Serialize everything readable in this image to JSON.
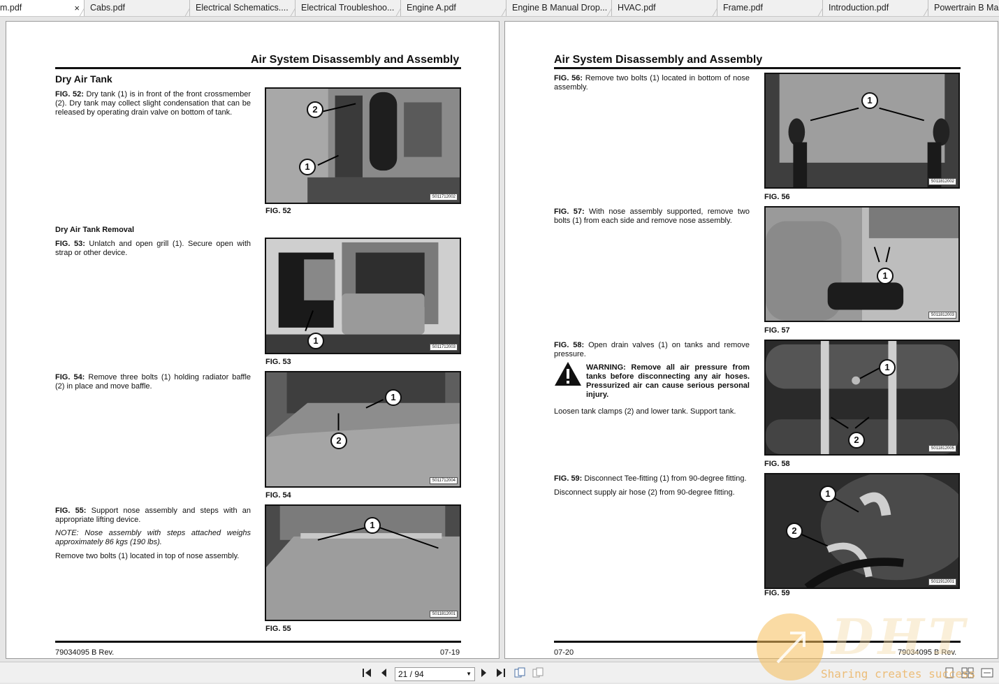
{
  "tabs": [
    {
      "label": "m.pdf",
      "active": true
    },
    {
      "label": "Cabs.pdf"
    },
    {
      "label": "Electrical Schematics...."
    },
    {
      "label": "Electrical Troubleshoo..."
    },
    {
      "label": "Engine A.pdf"
    },
    {
      "label": "Engine B Manual Drop..."
    },
    {
      "label": "HVAC.pdf"
    },
    {
      "label": "Frame.pdf"
    },
    {
      "label": "Introduction.pdf"
    },
    {
      "label": "Powertrain B Ma"
    }
  ],
  "tab_close": "×",
  "left_page": {
    "title": "Air System Disassembly and Assembly",
    "section": "Dry Air Tank",
    "subsection": "Dry Air Tank Removal",
    "fig52": {
      "lead": "FIG. 52:",
      "text": " Dry tank (1) is in front of the front crossmember (2). Dry tank may collect slight condensation that can be released by operating drain valve on bottom of tank.",
      "caption": "FIG. 52",
      "id": "S011712002",
      "c1": "1",
      "c2": "2"
    },
    "fig53": {
      "lead": "FIG. 53:",
      "text": " Unlatch and open grill (1). Secure open with strap or other device.",
      "caption": "FIG. 53",
      "id": "S011712003",
      "c1": "1"
    },
    "fig54": {
      "lead": "FIG. 54:",
      "text": " Remove three bolts (1) holding radiator baffle (2) in place and move baffle.",
      "caption": "FIG. 54",
      "id": "S011712004",
      "c1": "1",
      "c2": "2"
    },
    "fig55": {
      "lead": "FIG. 55:",
      "text": " Support nose assembly and steps with an appropriate lifting device.",
      "note": "NOTE: Nose assembly with steps attached weighs approximately 86 kgs (190 lbs).",
      "text2": "Remove two bolts (1) located in top of nose assembly.",
      "caption": "FIG. 55",
      "id": "S011812001",
      "c1": "1"
    },
    "footer_left": "79034095 B Rev.",
    "footer_right": "07-19"
  },
  "right_page": {
    "title": "Air System Disassembly and Assembly",
    "fig56": {
      "lead": "FIG. 56:",
      "text": " Remove two bolts (1) located in bottom of nose assembly.",
      "caption": "FIG. 56",
      "id": "S011812002",
      "c1": "1"
    },
    "fig57": {
      "lead": "FIG. 57:",
      "text": " With nose assembly supported, remove two bolts (1) from each side and remove nose assembly.",
      "caption": "FIG. 57",
      "id": "S011812003",
      "c1": "1"
    },
    "fig58": {
      "lead": "FIG. 58:",
      "text": " Open drain valves (1) on tanks and remove pressure.",
      "warning": "WARNING: Remove all air pressure from tanks before disconnecting any air hoses. Pressurized air can cause serious personal injury.",
      "text2": "Loosen tank clamps (2) and lower tank. Support tank.",
      "caption": "FIG. 58",
      "id": "S011812005",
      "c1": "1",
      "c2": "2"
    },
    "fig59": {
      "lead": "FIG. 59:",
      "text": " Disconnect Tee-fitting (1) from 90-degree fitting.",
      "text2": "Disconnect supply air hose (2) from 90-degree fitting.",
      "caption": "FIG. 59",
      "id": "S011912001",
      "c1": "1",
      "c2": "2"
    },
    "footer_left": "07-20",
    "footer_right": "79034095 B Rev."
  },
  "navigation": {
    "page_indicator": "21 / 94",
    "first_icon": "first-page-icon",
    "prev_icon": "prev-page-icon",
    "next_icon": "next-page-icon",
    "last_icon": "last-page-icon"
  },
  "watermark": {
    "logo": "DHT",
    "text": "Sharing creates success"
  }
}
